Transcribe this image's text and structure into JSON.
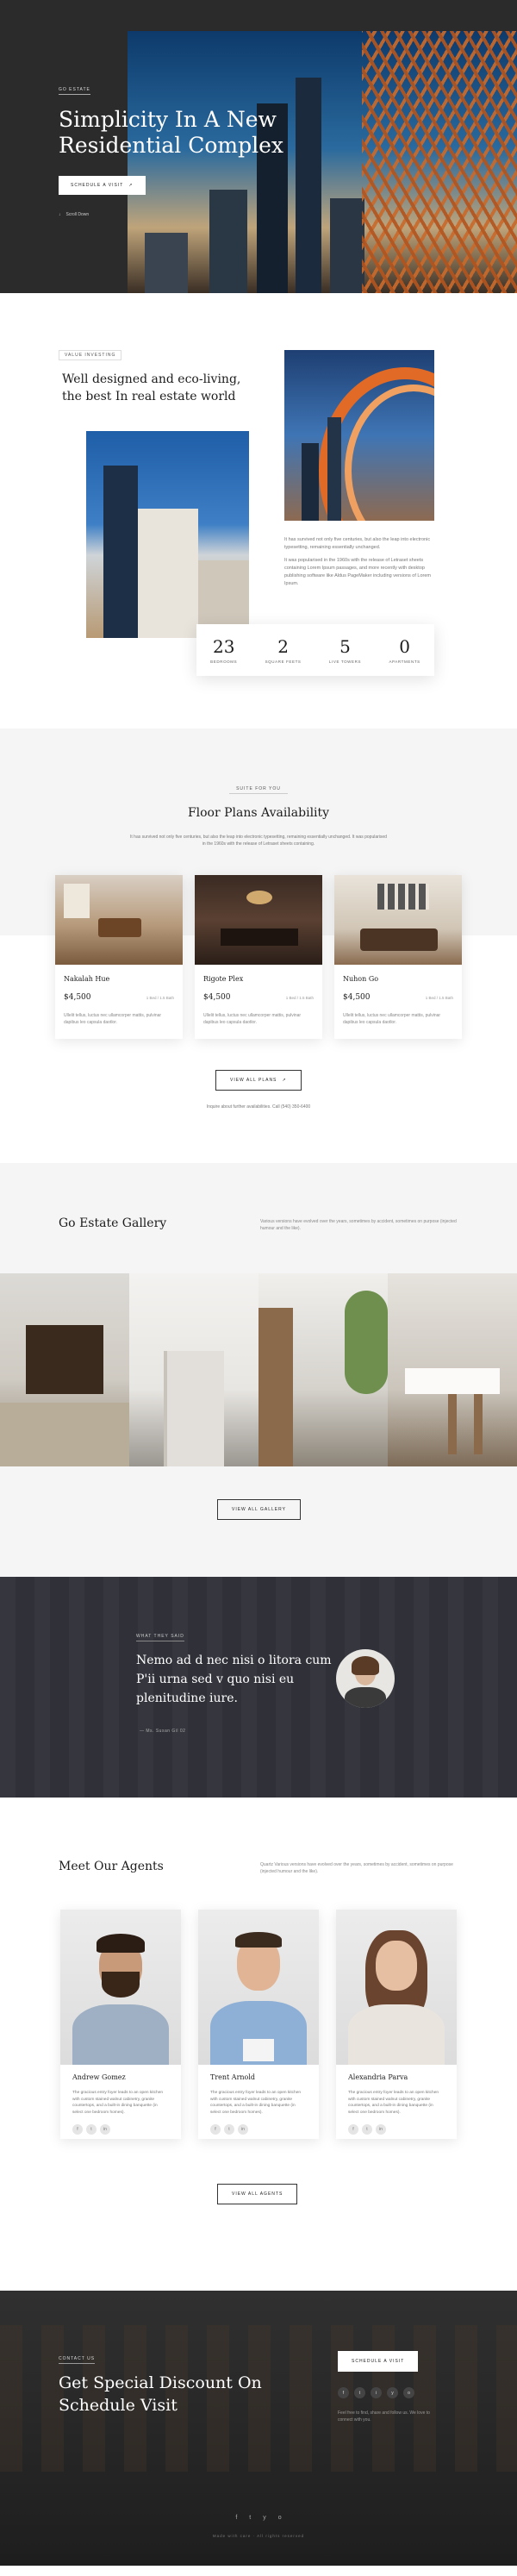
{
  "hero": {
    "eyebrow": "Go Estate",
    "title": "Simplicity In A New Residential Complex",
    "button_label": "Schedule A Visit",
    "button_arrow": "↗",
    "scroll_label": "Scroll Down",
    "scroll_icon": "↓"
  },
  "about": {
    "eyebrow": "Value Investing",
    "title": "Well designed and eco-living, the best In real estate world",
    "paragraph_1": "It has survived not only five centuries, but also the leap into electronic typesetting, remaining essentially unchanged.",
    "paragraph_2": "It was popularised in the 1960s with the release of Letraset sheets containing Lorem Ipsum passages, and more recently with desktop publishing software like Aldus PageMaker including versions of Lorem Ipsum.",
    "stats": [
      {
        "value": "23",
        "label": "Bedrooms"
      },
      {
        "value": "2",
        "label": "Square Feets"
      },
      {
        "value": "5",
        "label": "Live Towers"
      },
      {
        "value": "0",
        "label": "Apartments"
      }
    ]
  },
  "floor": {
    "eyebrow": "Suite For You",
    "title": "Floor Plans Availability",
    "description": "It has survived not only five centuries, but also the leap into electronic typesetting, remaining essentially unchanged. It was popularised in the 1960s with the release of Letraset sheets containing.",
    "cards": [
      {
        "title": "Nakalah Hue",
        "price": "$4,500",
        "meta": "1 Bed / 1.5 Bath",
        "text": "Ullelit tellus, luctus nec ullamcorper mattis, pulvinar dapibus leo capsula daotlor."
      },
      {
        "title": "Rigote Plex",
        "price": "$4,500",
        "meta": "1 Bed / 1.5 Bath",
        "text": "Ullelit tellus, luctus nec ullamcorper mattis, pulvinar dapibus leo capsula daotlor."
      },
      {
        "title": "Nuhon Go",
        "price": "$4,500",
        "meta": "1 Bed / 1.5 Bath",
        "text": "Ullelit tellus, luctus nec ullamcorper mattis, pulvinar dapibus leo capsula daotlor."
      }
    ],
    "button_label": "View All Plans",
    "button_arrow": "↗",
    "note": "Inquire about further availabilities. Call (540) 350-6400"
  },
  "gallery": {
    "title": "Go Estate Gallery",
    "description": "Various versions have evolved over the years, sometimes by accident, sometimes on purpose (injected humour and the like).",
    "button_label": "View All Gallery"
  },
  "testimonial": {
    "eyebrow": "What They Said",
    "quote": "Nemo ad d nec nisi o litora cum P'ii urna sed v quo nisi eu plenitudine iure.",
    "author": "— Ms. Susan Gil 02"
  },
  "agents": {
    "title": "Meet Our Agents",
    "description": "Quartz Various versions have evolved over the years, sometimes by accident, sometimes on purpose (injected humour and the like).",
    "list": [
      {
        "name": "Andrew Gomez",
        "bio": "The gracious entry foyer leads to an open kitchen with custom stained walnut cabinetry, granite countertops, and a built-in dining banquette (in select one bedroom homes)."
      },
      {
        "name": "Trent Arnold",
        "bio": "The gracious entry foyer leads to an open kitchen with custom stained walnut cabinetry, granite countertops, and a built-in dining banquette (in select one bedroom homes)."
      },
      {
        "name": "Alexandria Parva",
        "bio": "The gracious entry foyer leads to an open kitchen with custom stained walnut cabinetry, granite countertops, and a built-in dining banquette (in select one bedroom homes)."
      }
    ],
    "social": [
      "f",
      "t",
      "in"
    ],
    "button_label": "View All Agents"
  },
  "cta": {
    "eyebrow": "Contact Us",
    "title": "Get Special Discount On Schedule Visit",
    "button_label": "Schedule A Visit",
    "social": [
      "f",
      "t",
      "i",
      "y",
      "o"
    ],
    "text": "Feel free to find, share and follow us. We love to connect with you.",
    "footer_icons": [
      "f",
      "t",
      "y",
      "o"
    ],
    "copyright": "Made with care · All rights reserved"
  },
  "colors": {
    "dark": "#2b2b2b",
    "accent_orange": "#c96a2c",
    "testimonial_bg": "#2f3038"
  }
}
